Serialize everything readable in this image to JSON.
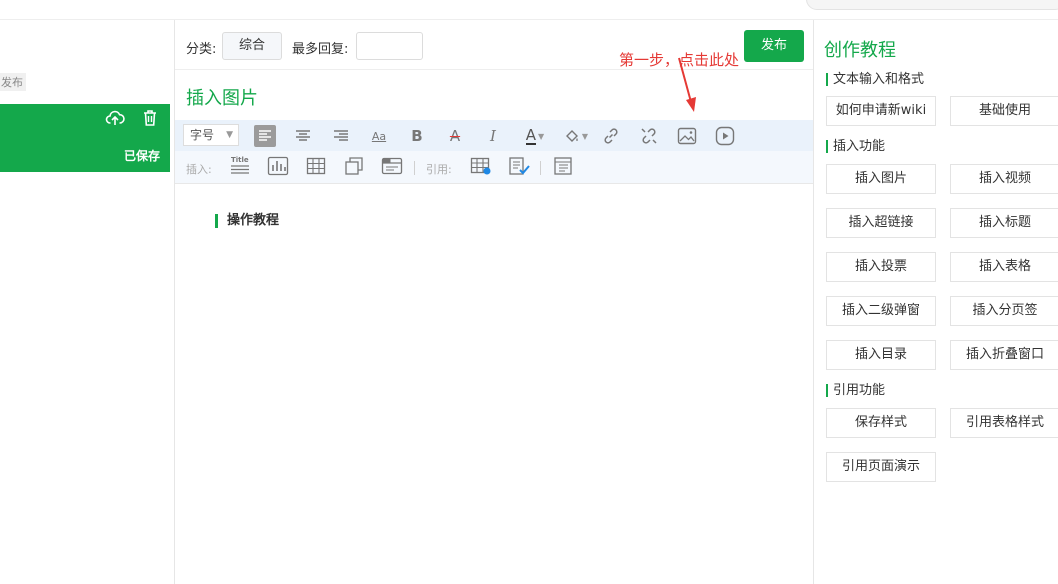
{
  "left": {
    "tag": "发布",
    "saved_status": "已保存"
  },
  "editor": {
    "category_label": "分类:",
    "category_value": "综合",
    "max_reply_label": "最多回复:",
    "max_reply_value": "",
    "publish_label": "发布",
    "annotation": "第一步，点击此处",
    "title": "插入图片",
    "font_size_label": "字号",
    "insert_label": "插入:",
    "cite_label": "引用:",
    "content_heading": "操作教程"
  },
  "right": {
    "title": "创作教程",
    "sections": [
      {
        "title": "文本输入和格式",
        "buttons": [
          "如何申请新wiki",
          "基础使用"
        ]
      },
      {
        "title": "插入功能",
        "buttons": [
          "插入图片",
          "插入视频",
          "插入超链接",
          "插入标题",
          "插入投票",
          "插入表格",
          "插入二级弹窗",
          "插入分页签",
          "插入目录",
          "插入折叠窗口"
        ]
      },
      {
        "title": "引用功能",
        "buttons": [
          "保存样式",
          "引用表格样式",
          "引用页面演示"
        ]
      }
    ]
  },
  "colors": {
    "accent": "#14a84b",
    "annotation": "#e53935"
  }
}
